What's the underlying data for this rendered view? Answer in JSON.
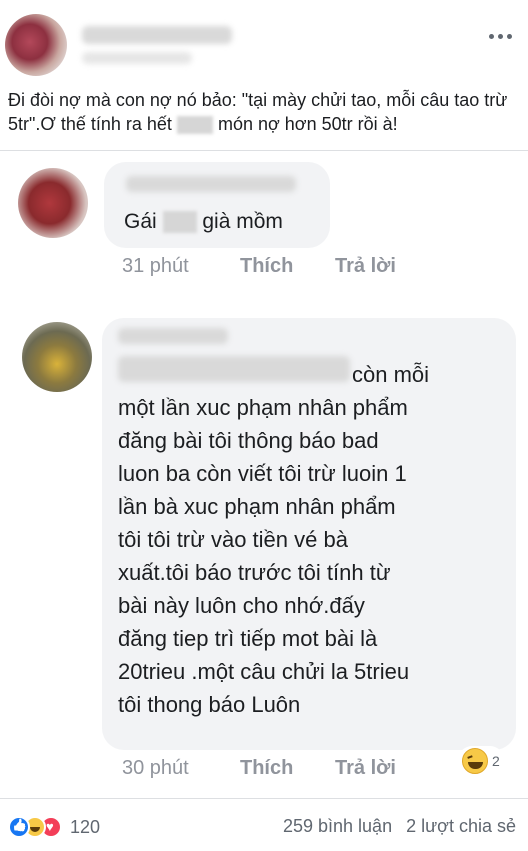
{
  "post": {
    "text_part1": "Đi đòi nợ mà con nợ nó bảo: \"tại mày chửi tao, mỗi câu tao trừ 5tr\".Ơ thế tính ra hết",
    "text_part2": "món nợ hơn 50tr rồi à!"
  },
  "comments": [
    {
      "text_part1": "Gái",
      "text_part2": "già mồm",
      "time": "31 phút",
      "like_label": "Thích",
      "reply_label": "Trả lời"
    },
    {
      "lines": [
        "còn mỗi",
        "một lần xuc phạm nhân phẩm",
        "đăng bài tôi thông báo bad",
        "luon ba còn viết tôi trừ luoin 1",
        "lần bà xuc phạm nhân phẩm",
        "tôi tôi trừ vào tiền vé bà",
        "xuất.tôi báo trước tôi tính từ",
        "bài này luôn cho nhớ.đấy",
        "đăng tiep trì tiếp mot bài là",
        "20trieu .một câu chửi la 5trieu",
        "tôi thong báo Luôn"
      ],
      "time": "30 phút",
      "like_label": "Thích",
      "reply_label": "Trả lời",
      "reaction_count": "2",
      "reaction_icon": "haha-icon"
    }
  ],
  "footer": {
    "reaction_count": "120",
    "reaction_icons": [
      "like-icon",
      "haha-icon",
      "love-icon"
    ],
    "comments_count": "259 bình luận",
    "shares_count": "2 lượt chia sẻ"
  },
  "colors": {
    "text": "#1c1e21",
    "meta": "#90949c",
    "bubble": "#f2f3f5",
    "like_blue": "#1877f2",
    "love_red": "#f33e58",
    "haha_yellow": "#f7c947"
  }
}
